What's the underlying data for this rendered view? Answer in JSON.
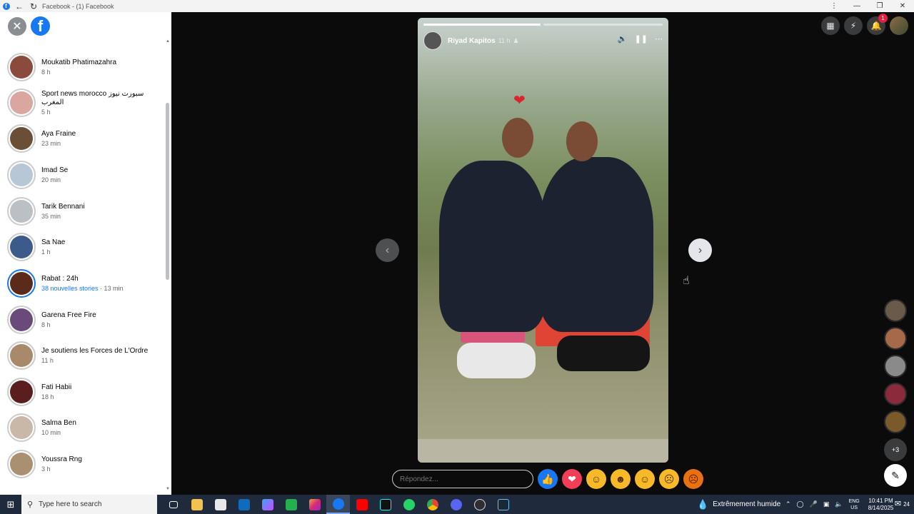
{
  "browser": {
    "title": "Facebook - (1) Facebook"
  },
  "sidebar": {
    "items": [
      {
        "name": "Moukatib Phatimazahra",
        "time": "8 h",
        "color": "#8a4a3c"
      },
      {
        "name": "Sport news morocco سبورت نيوز المغرب",
        "time": "5 h",
        "color": "#d9a7a0"
      },
      {
        "name": "Aya Fraine",
        "time": "23 min",
        "color": "#6b4e36"
      },
      {
        "name": "Imad Se",
        "time": "20 min",
        "color": "#b7c7d6"
      },
      {
        "name": "Tarik Bennani",
        "time": "35 min",
        "color": "#bcc0c4"
      },
      {
        "name": "Sa Nae",
        "time": "1 h",
        "color": "#3d5b8a"
      },
      {
        "name": "Rabat : 24h",
        "time_highlight": "38 nouvelles stories",
        "time": "· 13 min",
        "color": "#5a2a1a",
        "new": true
      },
      {
        "name": "Garena Free Fire",
        "time": "8 h",
        "color": "#6a4a7a"
      },
      {
        "name": "Je soutiens les Forces de L'Ordre",
        "time": "11 h",
        "color": "#a88a6a"
      },
      {
        "name": "Fati Habii",
        "time": "18 h",
        "color": "#5a1e1e"
      },
      {
        "name": "Salma Ben",
        "time": "10 min",
        "color": "#c9b7a8"
      },
      {
        "name": "Youssra Rng",
        "time": "3 h",
        "color": "#a89070"
      }
    ]
  },
  "story": {
    "author": "Riyad Kapitos",
    "time": "11 h",
    "progress_segments": [
      1.0,
      0.0
    ],
    "reply_placeholder": "Répondez..."
  },
  "viewers_more": "+3",
  "notifications_count": "1",
  "taskbar": {
    "search_placeholder": "Type here to search",
    "weather": "Extrêmement humide",
    "lang_top": "ENG",
    "lang_bottom": "US",
    "time": "10:41 PM",
    "date": "8/14/2025",
    "notif_count": "24"
  },
  "colors": {
    "facebook_blue": "#1877f2",
    "taskbar_bg": "#1f2a3c"
  }
}
